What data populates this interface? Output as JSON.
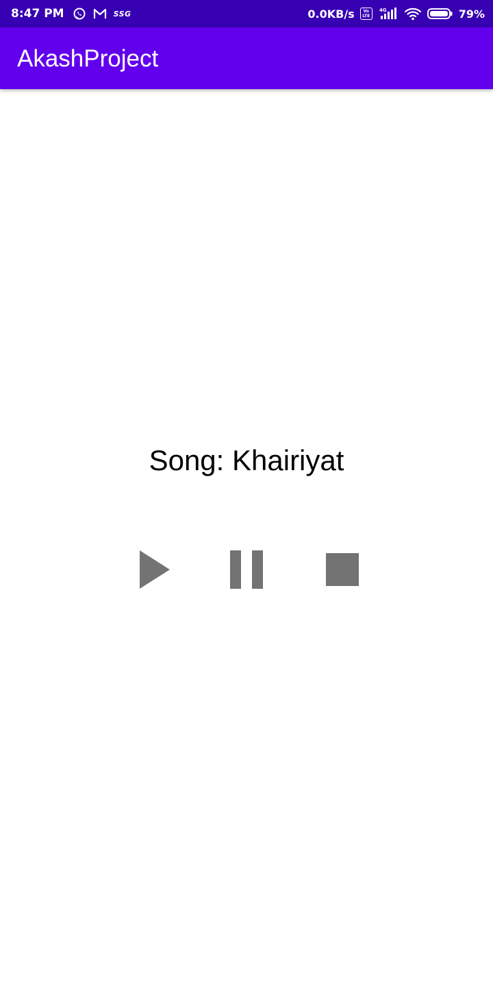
{
  "status_bar": {
    "time": "8:47 PM",
    "left_icons": [
      "whatsapp-icon",
      "gmail-icon",
      "ssg-icon"
    ],
    "ssg_label": "SSG",
    "network_speed": "0.0KB/s",
    "volte_top": "Vo",
    "volte_bottom": "LTE",
    "network_type": "4G",
    "battery_percent": "79%",
    "battery_level": 0.79
  },
  "app_bar": {
    "title": "AkashProject",
    "color": "#6200ee",
    "status_color": "#3700b3"
  },
  "player": {
    "song_label": "Song: Khairiyat",
    "controls": [
      "play-icon",
      "pause-icon",
      "stop-icon"
    ],
    "control_color": "#737373"
  }
}
